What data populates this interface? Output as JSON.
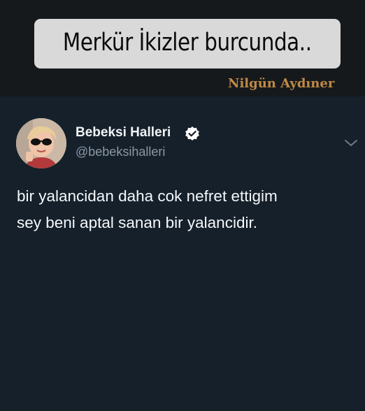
{
  "caption": {
    "text": "Merkür İkizler burcunda.."
  },
  "watermark": {
    "text": "Nilgün Aydıner"
  },
  "tweet": {
    "display_name": "Bebeksi Halleri",
    "handle": "@bebeksihalleri",
    "verified": true,
    "text": "bir yalancidan daha cok nefret ettigim\nsey beni aptal sanan bir yalancidir.",
    "icons": {
      "verified": "verified-badge-icon",
      "more": "chevron-down-icon"
    }
  },
  "colors": {
    "background": "#15202b",
    "top_band": "#16191c",
    "caption_box": "#d9d9d9",
    "watermark": "#c08a45",
    "name": "#f2f4f5",
    "handle": "#8a98a5"
  }
}
